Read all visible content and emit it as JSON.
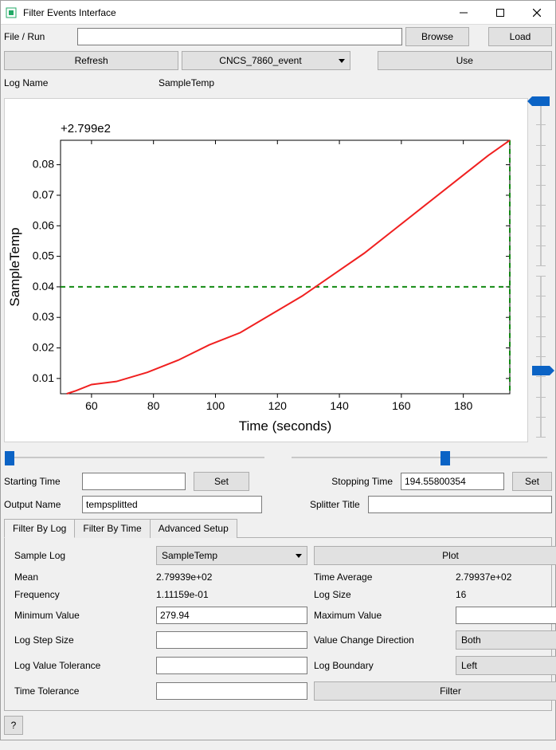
{
  "window": {
    "title": "Filter Events Interface"
  },
  "top": {
    "file_run_label": "File / Run",
    "file_run_value": "",
    "browse": "Browse",
    "load": "Load",
    "refresh": "Refresh",
    "dropdown": "CNCS_7860_event",
    "use": "Use",
    "log_name_label": "Log Name",
    "log_name_value": "SampleTemp"
  },
  "chart_data": {
    "type": "line",
    "title": "",
    "offset_label": "+2.799e2",
    "xlabel": "Time (seconds)",
    "ylabel": "SampleTemp",
    "xlim": [
      50,
      195
    ],
    "ylim": [
      0.005,
      0.088
    ],
    "xticks": [
      60,
      80,
      100,
      120,
      140,
      160,
      180
    ],
    "yticks": [
      0.01,
      0.02,
      0.03,
      0.04,
      0.05,
      0.06,
      0.07,
      0.08
    ],
    "series": [
      {
        "name": "SampleTemp",
        "color": "#f02020",
        "x": [
          52,
          55,
          60,
          68,
          78,
          88,
          98,
          108,
          118,
          128,
          138,
          148,
          158,
          168,
          178,
          188,
          195
        ],
        "y": [
          0.005,
          0.006,
          0.008,
          0.009,
          0.012,
          0.016,
          0.021,
          0.025,
          0.031,
          0.037,
          0.044,
          0.051,
          0.059,
          0.067,
          0.075,
          0.083,
          0.088
        ]
      }
    ],
    "guides": [
      {
        "type": "hline",
        "y": 0.04,
        "style": "dashed",
        "color": "#128a12"
      },
      {
        "type": "vline",
        "x": 195,
        "style": "dashed",
        "color": "#128a12"
      }
    ]
  },
  "sliders": {
    "top_y_percent": 1,
    "bottom_y_percent": 58,
    "left_x_percent": 1,
    "right_x_percent": 60
  },
  "time": {
    "start_label": "Starting Time",
    "start_value": "",
    "stop_label": "Stopping Time",
    "stop_value": "194.55800354",
    "set": "Set",
    "output_name_label": "Output Name",
    "output_name_value": "tempsplitted",
    "splitter_title_label": "Splitter Title",
    "splitter_title_value": ""
  },
  "tabs": {
    "log": "Filter By Log",
    "time": "Filter By Time",
    "adv": "Advanced Setup"
  },
  "log": {
    "sample_log_label": "Sample Log",
    "sample_log_value": "SampleTemp",
    "plot": "Plot",
    "mean_label": "Mean",
    "mean_value": "2.79939e+02",
    "time_avg_label": "Time Average",
    "time_avg_value": "2.79937e+02",
    "freq_label": "Frequency",
    "freq_value": "1.11159e-01",
    "log_size_label": "Log Size",
    "log_size_value": "16",
    "min_label": "Minimum Value",
    "min_value": "279.94",
    "max_label": "Maximum Value",
    "max_value": "",
    "step_label": "Log Step Size",
    "step_value": "",
    "dir_label": "Value Change Direction",
    "dir_value": "Both",
    "tol_label": "Log Value Tolerance",
    "tol_value": "",
    "bound_label": "Log Boundary",
    "bound_value": "Left",
    "time_tol_label": "Time Tolerance",
    "time_tol_value": "",
    "filter": "Filter"
  },
  "footer": {
    "help": "?"
  }
}
